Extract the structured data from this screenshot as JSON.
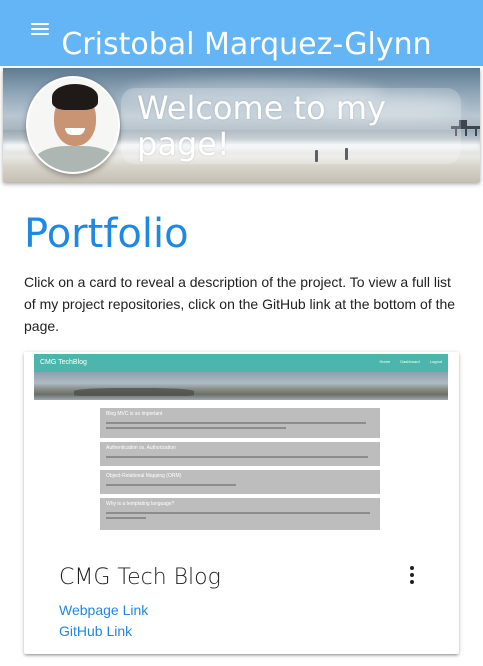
{
  "header": {
    "menu_icon": "hamburger-menu-icon",
    "title": "Cristobal Marquez-Glynn"
  },
  "hero": {
    "welcome": "Welcome to my page!",
    "avatar_icon": "profile-photo"
  },
  "portfolio": {
    "heading": "Portfolio",
    "intro": "Click on a card to reveal a description of the project. To view a full list of my project repositories, click on the GitHub link at the bottom of the page."
  },
  "card": {
    "preview": {
      "brand": "CMG TechBlog",
      "nav": [
        "Home",
        "Dashboard",
        "Logout"
      ],
      "posts": [
        "Blog MVC is so important",
        "Authentication vs. Authorization",
        "Object-Relational Mapping (ORM)",
        "Why is a templating language?"
      ]
    },
    "title": "CMG Tech Blog",
    "more_icon": "more-vert-icon",
    "links": {
      "webpage": "Webpage Link",
      "github": "GitHub Link"
    }
  },
  "colors": {
    "header_bg": "#64b5f6",
    "accent_blue": "#1e88e5",
    "preview_nav": "#4db6ac"
  }
}
